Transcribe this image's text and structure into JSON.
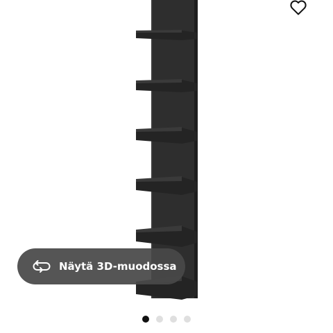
{
  "product_image": {
    "icon": "wall-shelf-unit-image",
    "color": "#2b2b2b"
  },
  "favourite": {
    "icon": "heart-icon"
  },
  "view3d": {
    "icon": "rotate-3d-icon",
    "label": "Näytä 3D-muodossa"
  },
  "carousel": {
    "total": 4,
    "active_index": 0
  }
}
